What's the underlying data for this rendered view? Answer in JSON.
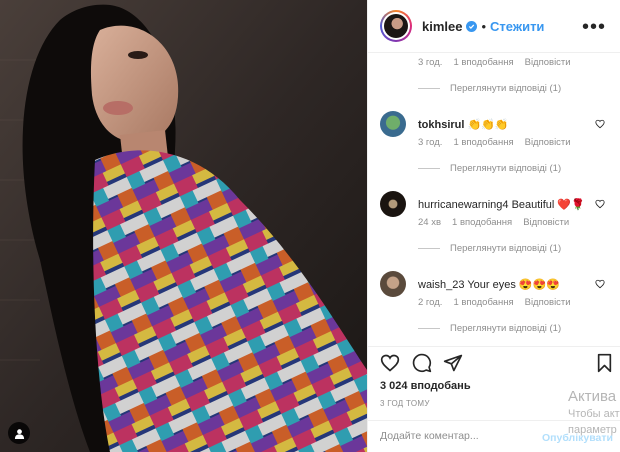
{
  "header": {
    "username": "kimlee",
    "separator": "•",
    "follow_label": "Стежити",
    "more_label": "•••"
  },
  "comments": {
    "first_partial": {
      "time": "3 год.",
      "likes": "1 вподобання",
      "reply": "Відповісти",
      "view_replies": "Переглянути відповіді (1)"
    },
    "items": [
      {
        "username": "tokhsirul",
        "text": "👏👏👏",
        "time": "3 год.",
        "likes": "1 вподобання",
        "reply": "Відповісти",
        "view_replies": "Переглянути відповіді (1)"
      },
      {
        "username": "hurricanewarning4",
        "text": "Beautiful ❤️🌹",
        "time": "24 хв",
        "likes": "1 вподобання",
        "reply": "Відповісти",
        "view_replies": "Переглянути відповіді (1)"
      },
      {
        "username": "waish_23",
        "text": "Your eyes 😍😍😍",
        "time": "2 год.",
        "likes": "1 вподобання",
        "reply": "Відповісти",
        "view_replies": "Переглянути відповіді (1)"
      }
    ]
  },
  "post": {
    "likes_count": "3 024 вподобань",
    "timestamp": "3 ГОД ТОМУ"
  },
  "add_comment": {
    "placeholder": "Додайте коментар...",
    "publish_label": "Опублікувати"
  },
  "watermark": {
    "line1": "Актива",
    "line2": "Чтобы акт",
    "line3": "параметр"
  },
  "icons": {
    "like": "heart-outline-icon",
    "comment": "speech-bubble-icon",
    "share": "paper-plane-icon",
    "save": "bookmark-icon",
    "verified": "verified-badge-icon",
    "user_tag": "user-tag-icon"
  },
  "colors": {
    "accent_blue": "#3897f0",
    "publish_disabled": "#b2dffc",
    "secondary_text": "#8e8e8e",
    "border": "#efefef"
  }
}
